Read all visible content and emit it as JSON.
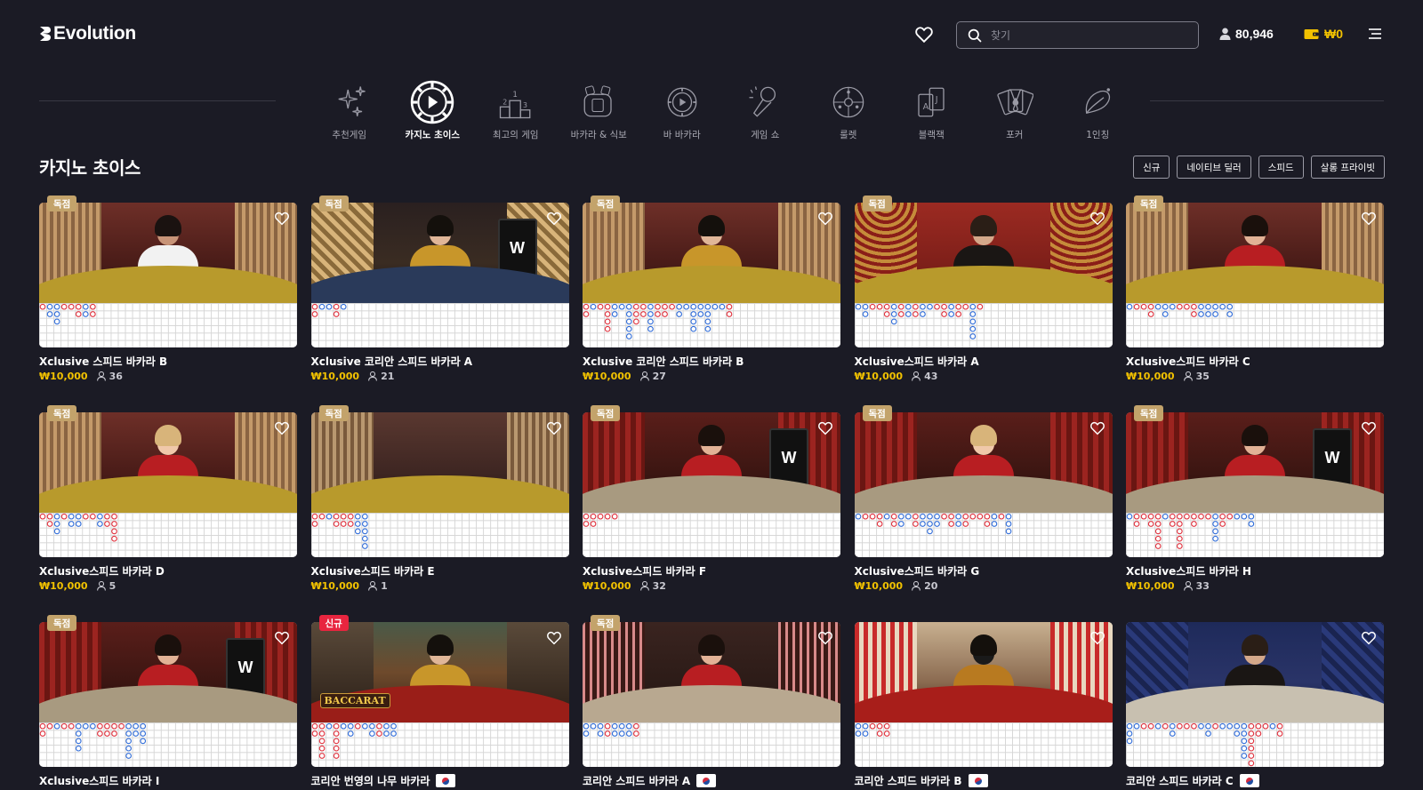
{
  "header": {
    "logo": "Evolution",
    "search_placeholder": "찾기",
    "online_players": "80,946",
    "balance": "₩0"
  },
  "nav": [
    {
      "label": "추천게임",
      "icon": "sparkles-icon",
      "active": false
    },
    {
      "label": "카지노 초이스",
      "icon": "casino-choice-icon",
      "active": true
    },
    {
      "label": "최고의 게임",
      "icon": "podium-icon",
      "active": false
    },
    {
      "label": "바카라 & 식보",
      "icon": "dice-baccarat-icon",
      "active": false
    },
    {
      "label": "바 바카라",
      "icon": "bar-baccarat-icon",
      "active": false
    },
    {
      "label": "게임 쇼",
      "icon": "microphone-icon",
      "active": false
    },
    {
      "label": "룰렛",
      "icon": "roulette-icon",
      "active": false
    },
    {
      "label": "블랙잭",
      "icon": "blackjack-icon",
      "active": false
    },
    {
      "label": "포커",
      "icon": "poker-icon",
      "active": false
    },
    {
      "label": "1인칭",
      "icon": "first-person-icon",
      "active": false
    }
  ],
  "section": {
    "title": "카지노 초이스",
    "filters": [
      "신규",
      "네이티브 딜러",
      "스피드",
      "살롱 프라이빗"
    ]
  },
  "games": [
    {
      "title": "Xclusive 스피드 바카라 B",
      "bet": "₩10,000",
      "players": "36",
      "badge": "독점",
      "badge_type": "exclusive",
      "scene": "gold",
      "dealer": "man-vest",
      "flag": false
    },
    {
      "title": "Xclusive 코리안 스피드 바카라 A",
      "bet": "₩10,000",
      "players": "21",
      "badge": "독점",
      "badge_type": "exclusive",
      "scene": "blue",
      "dealer": "woman-gold",
      "flag": false
    },
    {
      "title": "Xclusive 코리안 스피드 바카라 B",
      "bet": "₩10,000",
      "players": "27",
      "badge": "독점",
      "badge_type": "exclusive",
      "scene": "gold",
      "dealer": "woman-gold",
      "flag": false
    },
    {
      "title": "Xclusive스피드 바카라 A",
      "bet": "₩10,000",
      "players": "43",
      "badge": "독점",
      "badge_type": "exclusive",
      "scene": "gold-red",
      "dealer": "man-black",
      "flag": false
    },
    {
      "title": "Xclusive스피드 바카라 C",
      "bet": "₩10,000",
      "players": "35",
      "badge": "독점",
      "badge_type": "exclusive",
      "scene": "gold",
      "dealer": "woman-red",
      "flag": false
    },
    {
      "title": "Xclusive스피드 바카라 D",
      "bet": "₩10,000",
      "players": "5",
      "badge": "독점",
      "badge_type": "exclusive",
      "scene": "gold",
      "dealer": "woman-red-blonde",
      "flag": false
    },
    {
      "title": "Xclusive스피드 바카라 E",
      "bet": "₩10,000",
      "players": "1",
      "badge": "독점",
      "badge_type": "exclusive",
      "scene": "gold-empty",
      "dealer": "none",
      "flag": false
    },
    {
      "title": "Xclusive스피드 바카라 F",
      "bet": "₩10,000",
      "players": "32",
      "badge": "독점",
      "badge_type": "exclusive",
      "scene": "red-gray",
      "dealer": "woman-red",
      "flag": false
    },
    {
      "title": "Xclusive스피드 바카라 G",
      "bet": "₩10,000",
      "players": "20",
      "badge": "독점",
      "badge_type": "exclusive",
      "scene": "red-gray",
      "dealer": "woman-red-blonde",
      "flag": false
    },
    {
      "title": "Xclusive스피드 바카라 H",
      "bet": "₩10,000",
      "players": "33",
      "badge": "독점",
      "badge_type": "exclusive",
      "scene": "red-gray",
      "dealer": "woman-red",
      "flag": false
    },
    {
      "title": "Xclusive스피드 바카라 I",
      "bet": "",
      "players": "",
      "badge": "독점",
      "badge_type": "exclusive",
      "scene": "red-gray",
      "dealer": "woman-red",
      "flag": false
    },
    {
      "title": "코리안 번영의 나무 바카라",
      "bet": "",
      "players": "",
      "badge": "신규",
      "badge_type": "new",
      "scene": "tree",
      "dealer": "woman-gold",
      "flag": true,
      "logo_text": "BACCARAT"
    },
    {
      "title": "코리안 스피드 바카라 A",
      "bet": "",
      "players": "",
      "badge": "독점",
      "badge_type": "exclusive",
      "scene": "blossom",
      "dealer": "woman-red",
      "flag": true
    },
    {
      "title": "코리안 스피드 바카라 B",
      "bet": "",
      "players": "",
      "badge": "",
      "badge_type": "",
      "scene": "blossom-red",
      "dealer": "woman-gold-mask",
      "flag": true
    },
    {
      "title": "코리안 스피드 바카라 C",
      "bet": "",
      "players": "",
      "badge": "",
      "badge_type": "",
      "scene": "navy",
      "dealer": "man-black",
      "flag": true
    }
  ],
  "colors": {
    "bg": "#1b1b25",
    "accent_gold": "#f2c200",
    "badge_exclusive": "#c3a36b",
    "badge_new": "#e8253f",
    "road_player": "#2f6cd9",
    "road_banker": "#e0303c"
  }
}
